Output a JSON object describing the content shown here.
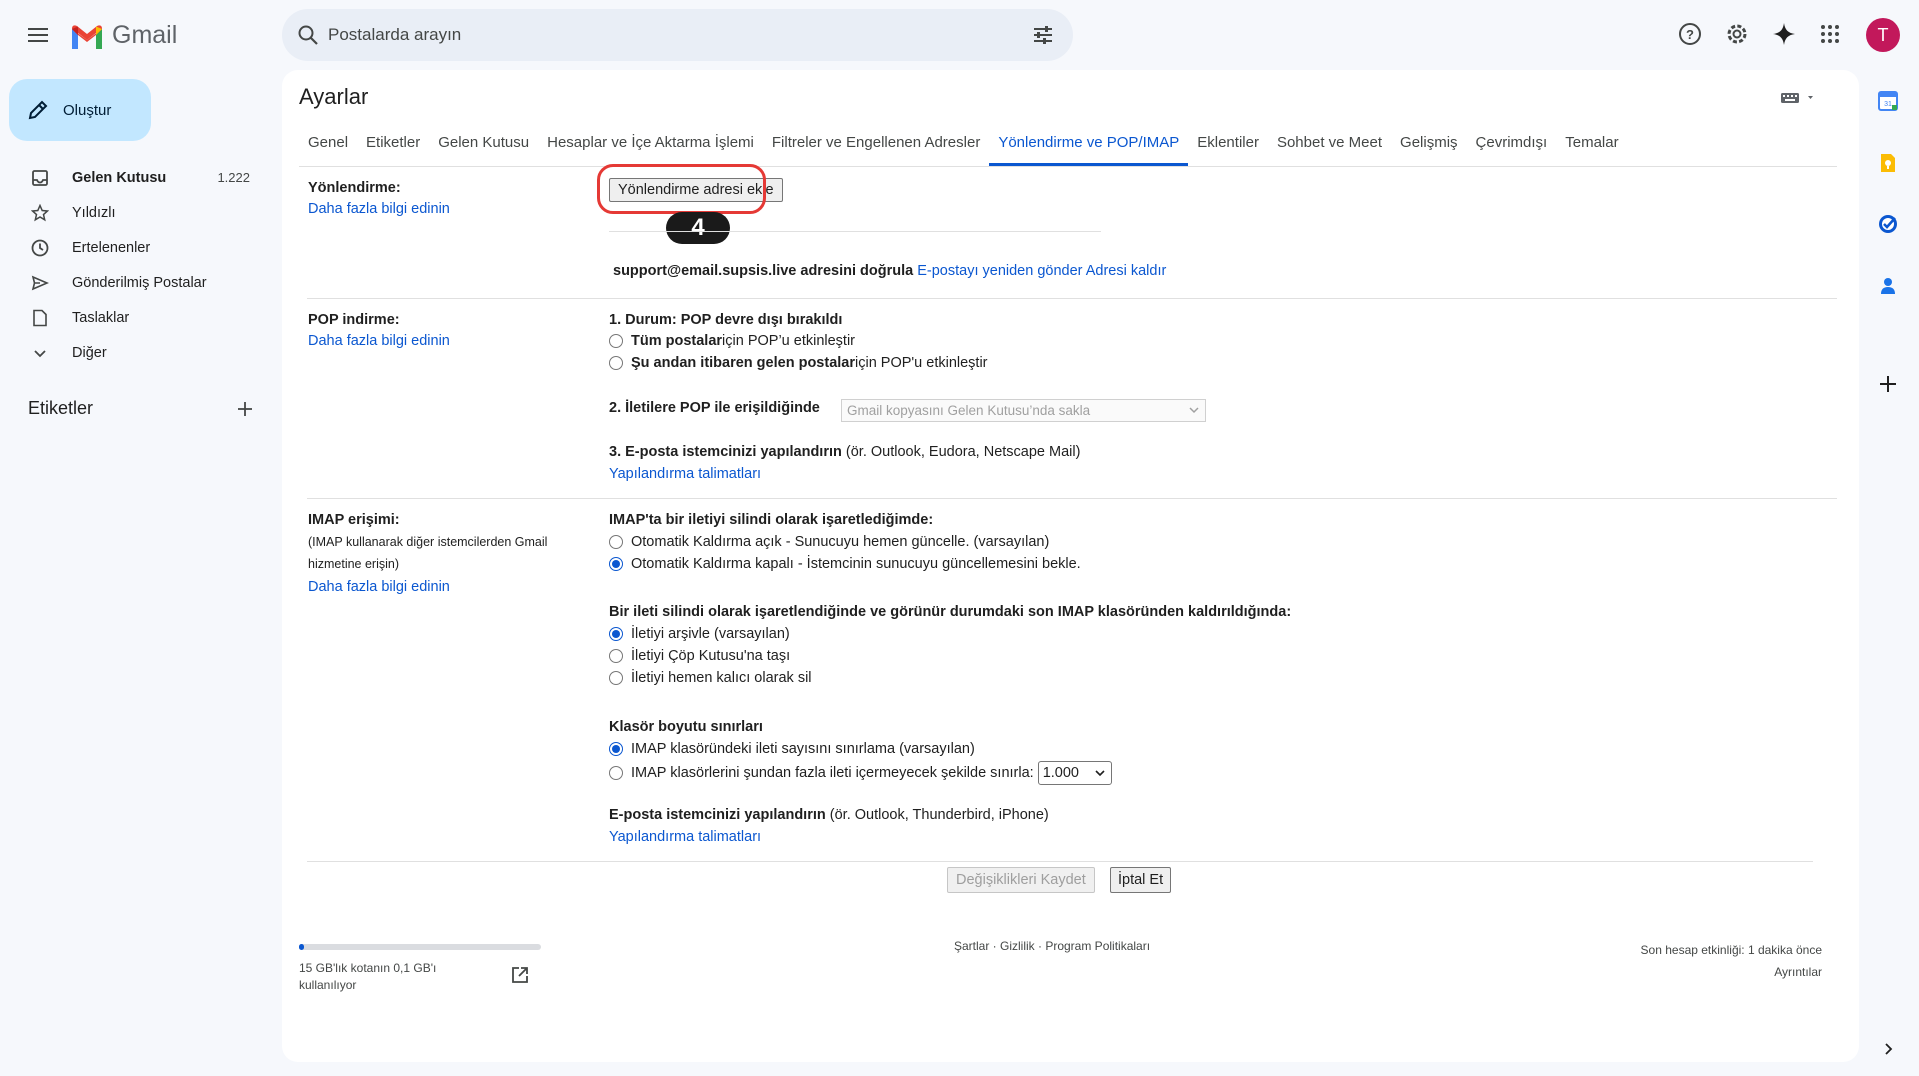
{
  "app": {
    "name": "Gmail"
  },
  "search": {
    "placeholder": "Postalarda arayın"
  },
  "icons": {
    "topbar": [
      "menu-icon",
      "search-icon",
      "tune-icon",
      "help-icon",
      "gear-icon",
      "gemini-icon",
      "apps-icon"
    ],
    "side": [
      "calendar-icon",
      "keep-icon",
      "tasks-icon",
      "contacts-icon",
      "add-icon"
    ]
  },
  "user": {
    "initial": "T",
    "color": "#c2185b"
  },
  "compose": {
    "label": "Oluştur"
  },
  "nav": {
    "items": [
      {
        "label": "Gelen Kutusu",
        "count": "1.222",
        "icon": "inbox-icon"
      },
      {
        "label": "Yıldızlı",
        "icon": "star-icon"
      },
      {
        "label": "Ertelenenler",
        "icon": "clock-icon"
      },
      {
        "label": "Gönderilmiş Postalar",
        "icon": "send-icon"
      },
      {
        "label": "Taslaklar",
        "icon": "draft-icon"
      },
      {
        "label": "Diğer",
        "icon": "chevron-down-icon"
      }
    ],
    "labels_header": "Etiketler"
  },
  "settings": {
    "title": "Ayarlar",
    "tabs": [
      {
        "label": "Genel"
      },
      {
        "label": "Etiketler"
      },
      {
        "label": "Gelen Kutusu"
      },
      {
        "label": "Hesaplar ve İçe Aktarma İşlemi"
      },
      {
        "label": "Filtreler ve Engellenen Adresler"
      },
      {
        "label": "Yönlendirme ve POP/IMAP",
        "active": true
      },
      {
        "label": "Eklentiler"
      },
      {
        "label": "Sohbet ve Meet"
      },
      {
        "label": "Gelişmiş"
      },
      {
        "label": "Çevrimdışı"
      },
      {
        "label": "Temalar"
      }
    ],
    "learn_more": "Daha fazla bilgi edinin",
    "forwarding": {
      "label": "Yönlendirme:",
      "add_button": "Yönlendirme adresi ekle",
      "step_badge": "4",
      "verify_address": "support@email.supsis.live adresini doğrula",
      "resend_link": "E-postayı yeniden gönder",
      "remove_link": "Adresi kaldır"
    },
    "pop": {
      "label": "POP indirme:",
      "status_prefix": "1. Durum: ",
      "status": "POP devre dışı bırakıldı",
      "option1_bold": "Tüm postalar",
      "option1_rest": " için POP’u etkinleştir",
      "option2_bold": "Şu andan itibaren gelen postalar",
      "option2_rest": " için POP'u etkinleştir",
      "access_label": "2. İletilere POP ile erişildiğinde",
      "access_value": "Gmail kopyasını Gelen Kutusu’nda sakla",
      "configure_label": "3. E-posta istemcinizi yapılandırın",
      "configure_note": " (ör. Outlook, Eudora, Netscape Mail)",
      "instructions_link": "Yapılandırma talimatları"
    },
    "imap": {
      "label": "IMAP erişimi:",
      "note": "(IMAP kullanarak diğer istemcilerden Gmail hizmetine erişin)",
      "deleted_heading": "IMAP'ta bir iletiyi silindi olarak işaretlediğimde:",
      "deleted_options": [
        {
          "label": "Otomatik Kaldırma açık - Sunucuyu hemen güncelle. (varsayılan)",
          "selected": false
        },
        {
          "label": "Otomatik Kaldırma kapalı - İstemcinin sunucuyu güncellemesini bekle.",
          "selected": true
        }
      ],
      "expunge_heading": "Bir ileti silindi olarak işaretlendiğinde ve görünür durumdaki son IMAP klasöründen kaldırıldığında:",
      "expunge_options": [
        {
          "label": "İletiyi arşivle (varsayılan)",
          "selected": true
        },
        {
          "label": "İletiyi Çöp Kutusu'na taşı",
          "selected": false
        },
        {
          "label": "İletiyi hemen kalıcı olarak sil",
          "selected": false
        }
      ],
      "folder_heading": "Klasör boyutu sınırları",
      "folder_option1": "IMAP klasöründeki ileti sayısını sınırlama (varsayılan)",
      "folder_option2": "IMAP klasörlerini şundan fazla ileti içermeyecek şekilde sınırla:",
      "folder_limit_value": "1.000",
      "configure_label": "E-posta istemcinizi yapılandırın",
      "configure_note": " (ör. Outlook, Thunderbird, iPhone)",
      "instructions_link": "Yapılandırma talimatları"
    },
    "save_button": "Değişiklikleri Kaydet",
    "cancel_button": "İptal Et"
  },
  "footer": {
    "quota_text": "15 GB'lık kotanın 0,1 GB'ı kullanılıyor",
    "quota_fraction": 0.007,
    "links": "Şartlar · Gizlilik · Program Politikaları",
    "activity": "Son hesap etkinliği: 1 dakika önce",
    "details": "Ayrıntılar"
  },
  "colors": {
    "accent": "#0b57d0",
    "compose_bg": "#c2e7ff",
    "highlight": "#e53935"
  }
}
